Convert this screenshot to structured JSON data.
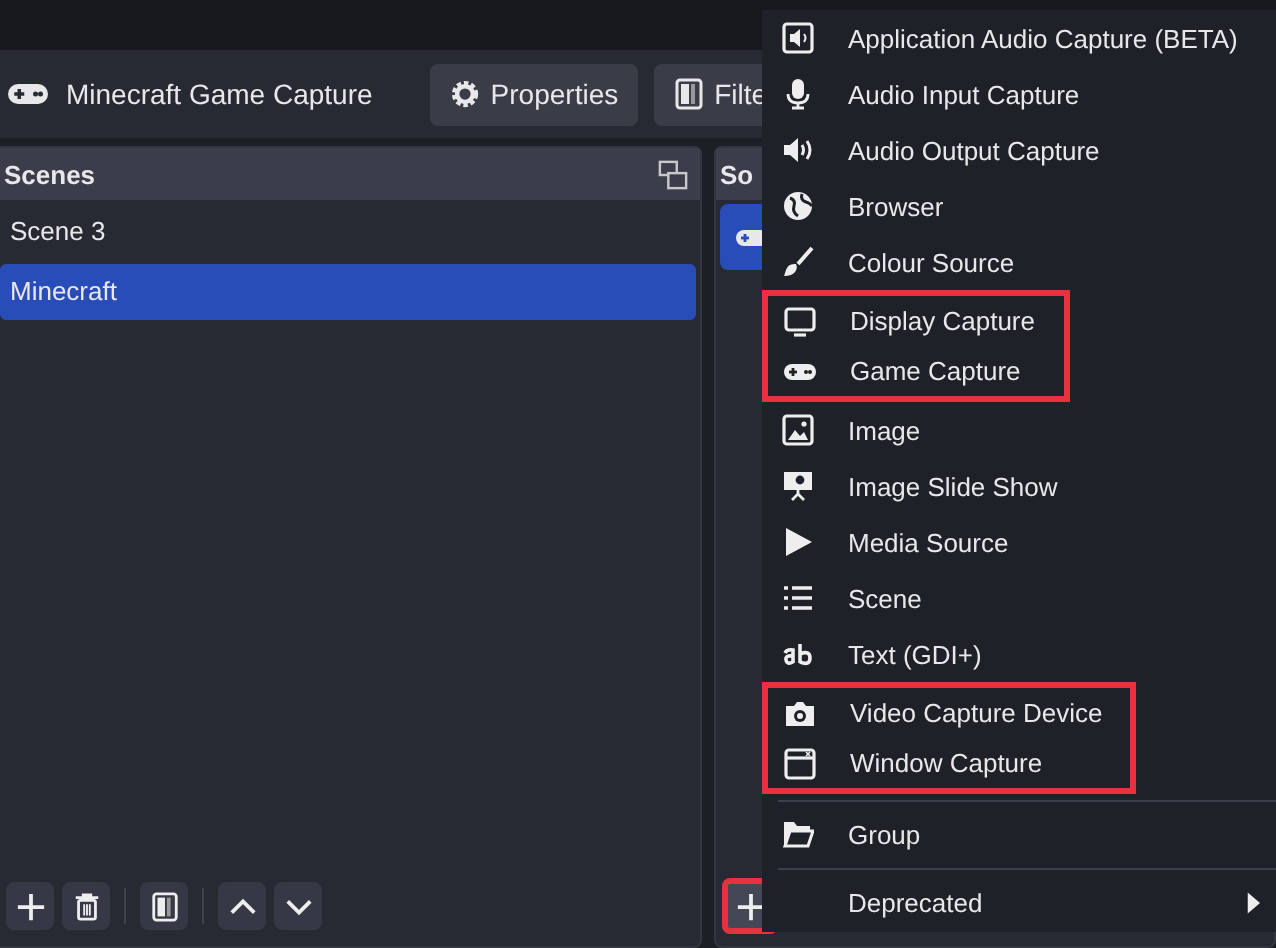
{
  "source_bar": {
    "name": "Minecraft Game Capture",
    "buttons": [
      {
        "label": "Properties"
      },
      {
        "label": "Filte"
      }
    ]
  },
  "scenes": {
    "title": "Scenes",
    "items": [
      {
        "label": "Scene 3",
        "selected": false
      },
      {
        "label": "Minecraft",
        "selected": true
      }
    ]
  },
  "sources": {
    "title": "So",
    "add_outlined": true
  },
  "menu": {
    "groups": [
      {
        "outlined": false,
        "divider_before": false,
        "items": [
          {
            "label": "Application Audio Capture (BETA)",
            "submenu": false
          },
          {
            "label": "Audio Input Capture",
            "submenu": false
          },
          {
            "label": "Audio Output Capture",
            "submenu": false
          },
          {
            "label": "Browser",
            "submenu": false
          },
          {
            "label": "Colour Source",
            "submenu": false
          }
        ]
      },
      {
        "outlined": true,
        "divider_before": false,
        "items": [
          {
            "label": "Display Capture",
            "submenu": false
          },
          {
            "label": "Game Capture",
            "submenu": false
          }
        ]
      },
      {
        "outlined": false,
        "divider_before": false,
        "items": [
          {
            "label": "Image",
            "submenu": false
          },
          {
            "label": "Image Slide Show",
            "submenu": false
          },
          {
            "label": "Media Source",
            "submenu": false
          },
          {
            "label": "Scene",
            "submenu": false
          },
          {
            "label": "Text (GDI+)",
            "submenu": false
          }
        ]
      },
      {
        "outlined": true,
        "divider_before": false,
        "items": [
          {
            "label": "Video Capture Device",
            "submenu": false
          },
          {
            "label": "Window Capture",
            "submenu": false
          }
        ]
      },
      {
        "outlined": false,
        "divider_before": true,
        "items": [
          {
            "label": "Group",
            "submenu": false
          }
        ]
      },
      {
        "outlined": false,
        "divider_before": true,
        "items": [
          {
            "label": "Deprecated",
            "submenu": true
          }
        ]
      }
    ]
  }
}
